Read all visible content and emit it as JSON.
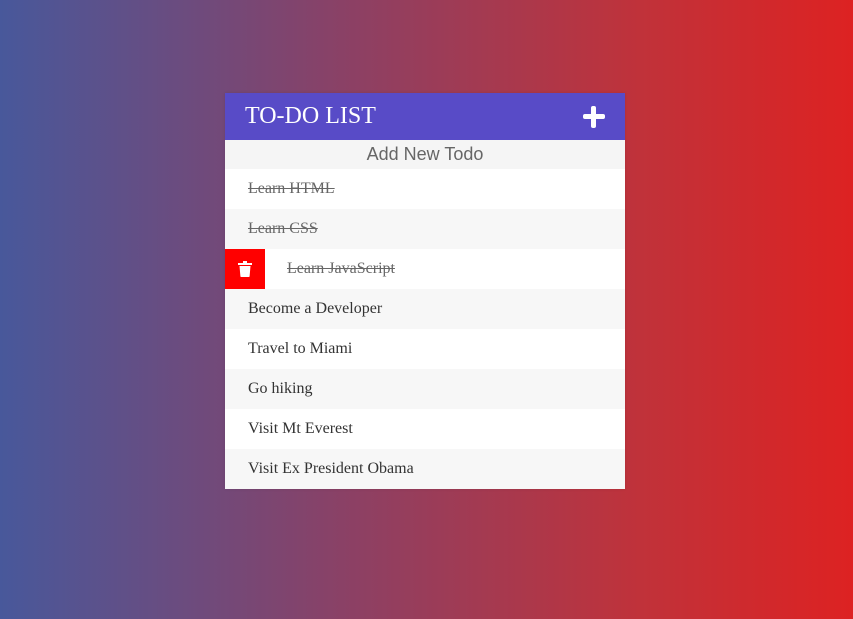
{
  "app": {
    "title": "TO-DO LIST",
    "add_icon": "plus-icon"
  },
  "new_todo": {
    "placeholder": "Add New Todo",
    "value": ""
  },
  "todos": [
    {
      "text": "Learn HTML",
      "completed": true
    },
    {
      "text": "Learn CSS",
      "completed": true
    },
    {
      "text": "Learn JavaScript",
      "completed": true,
      "hovered": true
    },
    {
      "text": "Become a Developer",
      "completed": false
    },
    {
      "text": "Travel to Miami",
      "completed": false
    },
    {
      "text": "Go hiking",
      "completed": false
    },
    {
      "text": "Visit Mt Everest",
      "completed": false
    },
    {
      "text": "Visit Ex President Obama",
      "completed": false
    }
  ],
  "delete_icon": "trash-icon",
  "colors": {
    "header": "#584bc7",
    "delete": "#ff0000",
    "gradient_start": "#48589b",
    "gradient_end": "#dd2222"
  }
}
